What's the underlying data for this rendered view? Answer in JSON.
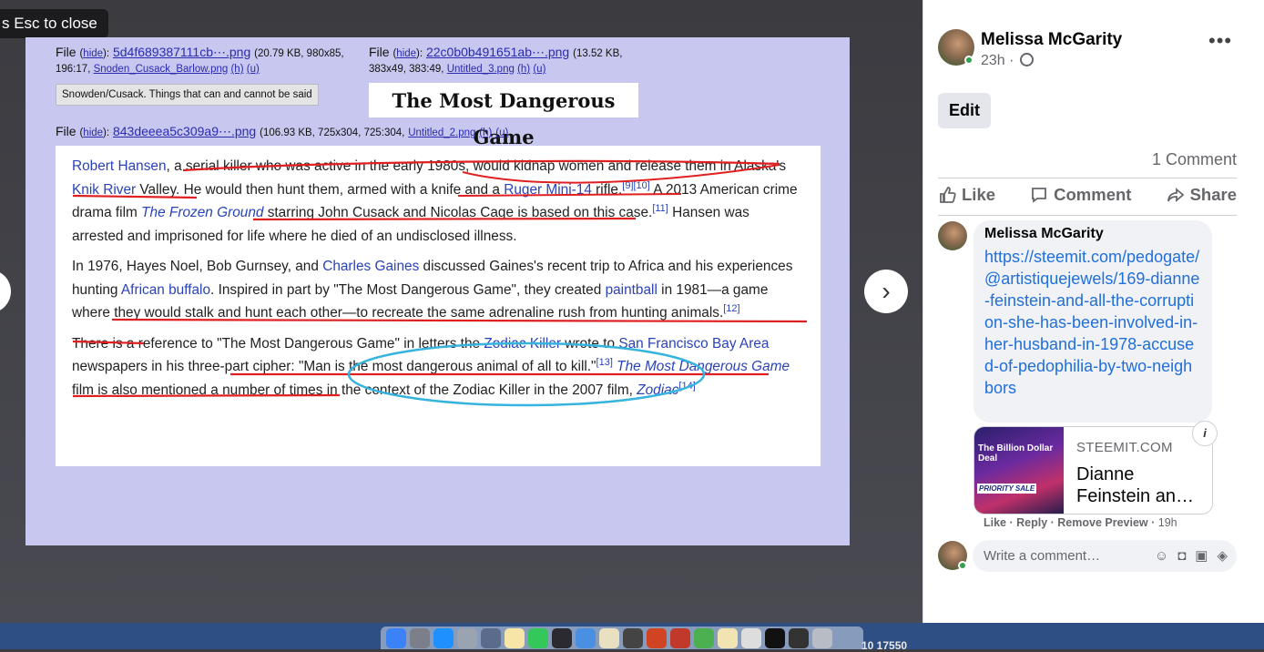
{
  "viewer": {
    "esc_tip": "s Esc to close",
    "file1": {
      "label": "File",
      "hide": "hide",
      "name": "5d4f689387111cb⋯.png",
      "meta_a": "(20.79 KB, 980x85,",
      "meta_b": "196:17,",
      "orig": "Snoden_Cusack_Barlow.png",
      "h": "(h)",
      "u": "(u)"
    },
    "file2": {
      "label": "File",
      "hide": "hide",
      "name": "22c0b0b491651ab⋯.png",
      "meta_a": "(13.52 KB,",
      "meta_b": "383x49, 383:49,",
      "orig": "Untitled_3.png",
      "h": "(h)",
      "u": "(u)"
    },
    "file3": {
      "label": "File",
      "hide": "hide",
      "name": "843deeea5c309a9⋯.png",
      "meta": "(106.93 KB, 725x304, 725:304,",
      "orig": "Untitled_2.png",
      "h": "(h)",
      "u": "(u)"
    },
    "caption": "Snowden/Cusack. Things that can and cannot be said",
    "title_image": "The Most Dangerous Game",
    "article": {
      "p1": {
        "link_hansen": "Robert Hansen",
        "t1": ", a serial killer who was active in the early 1980s, would kidnap women and release them in Alaska's ",
        "link_knik": "Knik River",
        "t2": " Valley. He would then hunt them, armed with a knife and a ",
        "link_ruger": "Ruger Mini-14",
        "t3": " rifle.",
        "sup1": "[9][10]",
        "t4": " A 2013 American crime drama film ",
        "link_film": "The Frozen Ground",
        "t5": " starring John Cusack and Nicolas Cage is based on this case.",
        "sup2": "[11]",
        "t6": " Hansen was arrested and imprisoned for life where he died of an undisclosed illness."
      },
      "p2": {
        "t1": "In 1976, Hayes Noel, Bob Gurnsey, and ",
        "link_gaines": "Charles Gaines",
        "t2": " discussed Gaines's recent trip to Africa and his experiences hunting ",
        "link_buffalo": "African buffalo",
        "t3": ". Inspired in part by \"The Most Dangerous Game\", they created ",
        "link_paintball": "paintball",
        "t4": " in 1981—a game where they would stalk and hunt each other—to recreate the same adrenaline rush from hunting animals.",
        "sup": "[12]"
      },
      "p3": {
        "t1": "There is a reference to \"The Most Dangerous Game\" in letters the ",
        "link_zodiac": "Zodiac Killer",
        "t2": " wrote to ",
        "link_sf": "San Francisco Bay Area",
        "t3": " newspapers in his three-part cipher: \"Man is the most dangerous animal of all to kill.\"",
        "sup1": "[13]",
        "link_mdg": "The Most Dangerous Game",
        "t4": " film is also mentioned a number of times in the context of the Zodiac Killer in the 2007 film, ",
        "link_zodiac_film": "Zodiac",
        "sup2": "[14]"
      }
    },
    "prev_icon": "chevron-left-icon",
    "next_icon": "chevron-right-icon"
  },
  "post": {
    "author": "Melissa McGarity",
    "time": "23h ·",
    "privacy_icon": "globe-icon",
    "more": "•••",
    "edit_label": "Edit",
    "comment_count": "1 Comment",
    "actions": {
      "like": "Like",
      "comment": "Comment",
      "share": "Share"
    }
  },
  "comment": {
    "author": "Melissa McGarity",
    "text": "https://steemit.com/pedogate/@artistiquejewels/169-dianne-feinstein-and-all-the-corruption-she-has-been-involved-in-her-husband-in-1978-accused-of-pedophilia-by-two-neighbors",
    "link_card": {
      "thumb_title": "The Billion Dollar Deal",
      "thumb_tag": "PRIORITY SALE",
      "site": "STEEMIT.COM",
      "title": "Dianne Feinstein an…",
      "info": "i"
    },
    "meta": {
      "like": "Like",
      "reply": "Reply",
      "remove": "Remove Preview",
      "time": "19h"
    }
  },
  "composer": {
    "placeholder": "Write a comment…"
  },
  "dock": {
    "note": "10 17550"
  }
}
